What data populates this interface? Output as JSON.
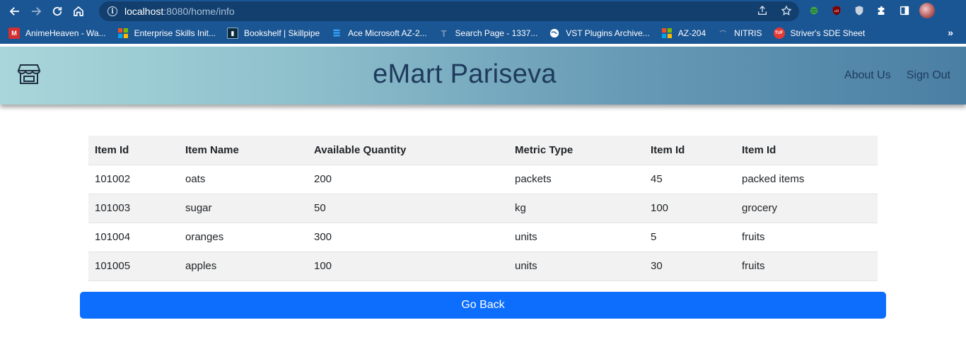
{
  "browser": {
    "url_host": "localhost",
    "url_path": ":8080/home/info",
    "bookmarks": [
      {
        "label": "AnimeHeaven - Wa...",
        "icon": "animeheaven-icon",
        "color": "#d32f2f"
      },
      {
        "label": "Enterprise Skills Init...",
        "icon": "microsoft-icon",
        "color": "#f25022"
      },
      {
        "label": "Bookshelf | Skillpipe",
        "icon": "bookshelf-icon",
        "color": "#0b2b3f"
      },
      {
        "label": "Ace Microsoft AZ-2...",
        "icon": "azure-icon",
        "color": "#0078d4"
      },
      {
        "label": "Search Page - 1337...",
        "icon": "search-page-icon",
        "color": "#2b4d7a"
      },
      {
        "label": "VST Plugins Archive...",
        "icon": "globe-icon",
        "color": "#ffffff"
      },
      {
        "label": "AZ-204",
        "icon": "microsoft-icon",
        "color": "#f25022"
      },
      {
        "label": "NITRIS",
        "icon": "nitris-icon",
        "color": "#1b3f6e"
      },
      {
        "label": "Striver's SDE Sheet",
        "icon": "takeuforward-icon",
        "color": "#e53935"
      }
    ]
  },
  "header": {
    "brand": "eMart Pariseva",
    "links": [
      "About Us",
      "Sign Out"
    ]
  },
  "table": {
    "columns": [
      "Item Id",
      "Item Name",
      "Available Quantity",
      "Metric Type",
      "Item Id",
      "Item Id"
    ],
    "rows": [
      [
        "101002",
        "oats",
        "200",
        "packets",
        "45",
        "packed items"
      ],
      [
        "101003",
        "sugar",
        "50",
        "kg",
        "100",
        "grocery"
      ],
      [
        "101004",
        "oranges",
        "300",
        "units",
        "5",
        "fruits"
      ],
      [
        "101005",
        "apples",
        "100",
        "units",
        "30",
        "fruits"
      ]
    ]
  },
  "actions": {
    "go_back": "Go Back"
  },
  "colors": {
    "primary": "#0d6efd",
    "brand_text": "#1f3a5c"
  }
}
